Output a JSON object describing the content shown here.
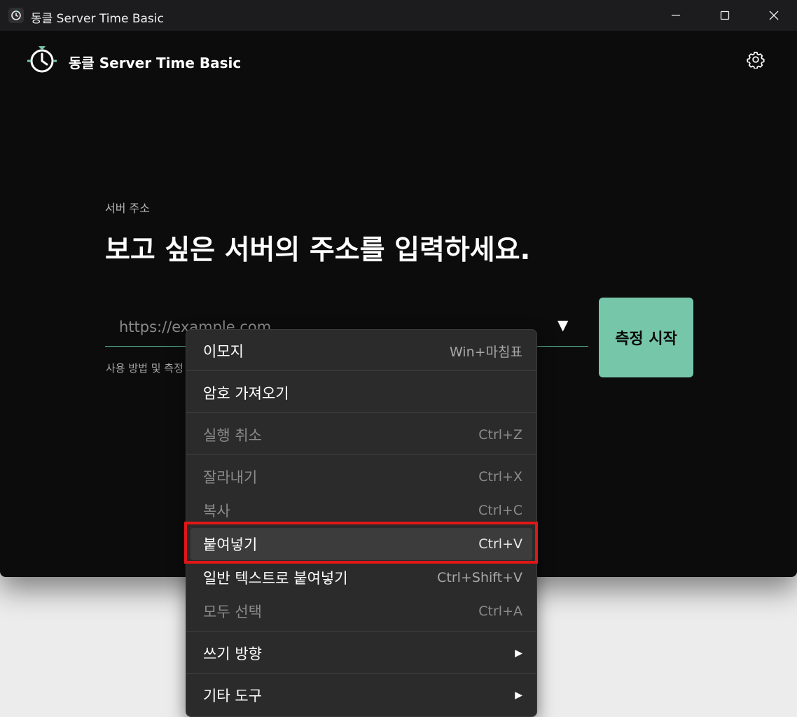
{
  "window": {
    "title": "동클 Server Time Basic"
  },
  "app": {
    "title": "동클 Server Time Basic"
  },
  "form": {
    "label": "서버 주소",
    "heading": "보고 싶은 서버의 주소를 입력하세요.",
    "placeholder": "https://example.com",
    "start_button": "측정 시작",
    "help_text": "사용 방법 및 측정"
  },
  "context_menu": {
    "items": [
      {
        "label": "이모지",
        "shortcut": "Win+마침표",
        "enabled": true
      },
      {
        "label": "암호 가져오기",
        "shortcut": "",
        "enabled": true
      },
      {
        "label": "실행 취소",
        "shortcut": "Ctrl+Z",
        "enabled": false
      },
      {
        "label": "잘라내기",
        "shortcut": "Ctrl+X",
        "enabled": false
      },
      {
        "label": "복사",
        "shortcut": "Ctrl+C",
        "enabled": false
      },
      {
        "label": "붙여넣기",
        "shortcut": "Ctrl+V",
        "enabled": true,
        "highlighted": true
      },
      {
        "label": "일반 텍스트로 붙여넣기",
        "shortcut": "Ctrl+Shift+V",
        "enabled": true
      },
      {
        "label": "모두 선택",
        "shortcut": "Ctrl+A",
        "enabled": false
      },
      {
        "label": "쓰기 방향",
        "shortcut": "",
        "enabled": true,
        "submenu": true
      },
      {
        "label": "기타 도구",
        "shortcut": "",
        "enabled": true,
        "submenu": true
      }
    ]
  },
  "colors": {
    "accent": "#76c6aa",
    "highlight_box": "#e01717",
    "background": "#0c0c0d"
  }
}
